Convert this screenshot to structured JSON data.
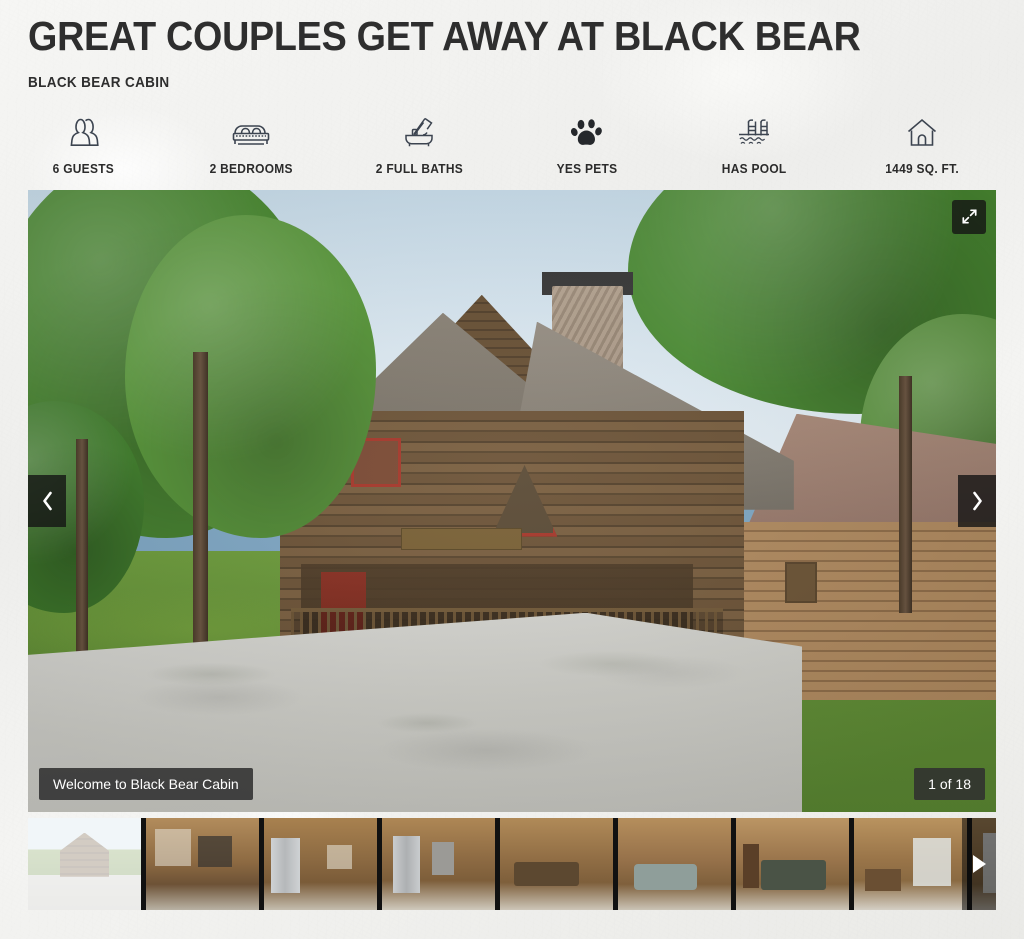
{
  "header": {
    "title": "GREAT COUPLES GET AWAY AT BLACK BEAR",
    "subtitle": "BLACK BEAR CABIN"
  },
  "features": [
    {
      "icon": "guests-icon",
      "label": "6 GUESTS"
    },
    {
      "icon": "bed-icon",
      "label": "2 BEDROOMS"
    },
    {
      "icon": "bathtub-icon",
      "label": "2 FULL BATHS"
    },
    {
      "icon": "paw-icon",
      "label": "YES PETS"
    },
    {
      "icon": "pool-icon",
      "label": "HAS POOL"
    },
    {
      "icon": "house-icon",
      "label": "1449 SQ. FT."
    }
  ],
  "gallery": {
    "caption": "Welcome to Black Bear Cabin",
    "counter": "1 of 18",
    "prev_label": "Previous image",
    "next_label": "Next image",
    "expand_label": "Expand image",
    "thumbs_next_label": "More thumbnails",
    "thumbnails": [
      {
        "name": "thumbnail-exterior",
        "art": "art-exterior",
        "active": true
      },
      {
        "name": "thumbnail-living-room",
        "art": "art-living",
        "active": false
      },
      {
        "name": "thumbnail-kitchen",
        "art": "art-kitchen",
        "active": false
      },
      {
        "name": "thumbnail-kitchen-2",
        "art": "art-kitchen2",
        "active": false
      },
      {
        "name": "thumbnail-dining",
        "art": "art-dining",
        "active": false
      },
      {
        "name": "thumbnail-lounge",
        "art": "art-lounge",
        "active": false
      },
      {
        "name": "thumbnail-bedroom",
        "art": "art-bedroom",
        "active": false
      },
      {
        "name": "thumbnail-bathroom",
        "art": "art-bath",
        "active": false
      },
      {
        "name": "thumbnail-laundry",
        "art": "art-laundry",
        "active": false
      },
      {
        "name": "thumbnail-hallway",
        "art": "art-hall",
        "active": false
      },
      {
        "name": "thumbnail-partial",
        "art": "art-partial",
        "active": false
      }
    ]
  },
  "colors": {
    "page_background": "#f2f2f0",
    "text": "#2b2b2b",
    "icon_stroke": "#3c4450",
    "overlay": "#303030"
  }
}
